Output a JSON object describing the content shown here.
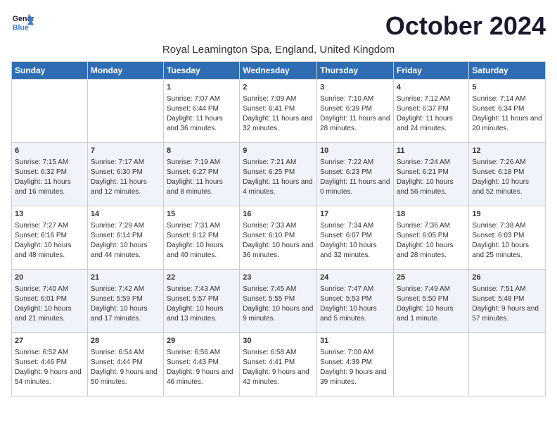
{
  "logo": {
    "line1": "General",
    "line2": "Blue"
  },
  "title": "October 2024",
  "subtitle": "Royal Leamington Spa, England, United Kingdom",
  "days_of_week": [
    "Sunday",
    "Monday",
    "Tuesday",
    "Wednesday",
    "Thursday",
    "Friday",
    "Saturday"
  ],
  "weeks": [
    [
      {
        "day": "",
        "sunrise": "",
        "sunset": "",
        "daylight": ""
      },
      {
        "day": "",
        "sunrise": "",
        "sunset": "",
        "daylight": ""
      },
      {
        "day": "1",
        "sunrise": "Sunrise: 7:07 AM",
        "sunset": "Sunset: 6:44 PM",
        "daylight": "Daylight: 11 hours and 36 minutes."
      },
      {
        "day": "2",
        "sunrise": "Sunrise: 7:09 AM",
        "sunset": "Sunset: 6:41 PM",
        "daylight": "Daylight: 11 hours and 32 minutes."
      },
      {
        "day": "3",
        "sunrise": "Sunrise: 7:10 AM",
        "sunset": "Sunset: 6:39 PM",
        "daylight": "Daylight: 11 hours and 28 minutes."
      },
      {
        "day": "4",
        "sunrise": "Sunrise: 7:12 AM",
        "sunset": "Sunset: 6:37 PM",
        "daylight": "Daylight: 11 hours and 24 minutes."
      },
      {
        "day": "5",
        "sunrise": "Sunrise: 7:14 AM",
        "sunset": "Sunset: 6:34 PM",
        "daylight": "Daylight: 11 hours and 20 minutes."
      }
    ],
    [
      {
        "day": "6",
        "sunrise": "Sunrise: 7:15 AM",
        "sunset": "Sunset: 6:32 PM",
        "daylight": "Daylight: 11 hours and 16 minutes."
      },
      {
        "day": "7",
        "sunrise": "Sunrise: 7:17 AM",
        "sunset": "Sunset: 6:30 PM",
        "daylight": "Daylight: 11 hours and 12 minutes."
      },
      {
        "day": "8",
        "sunrise": "Sunrise: 7:19 AM",
        "sunset": "Sunset: 6:27 PM",
        "daylight": "Daylight: 11 hours and 8 minutes."
      },
      {
        "day": "9",
        "sunrise": "Sunrise: 7:21 AM",
        "sunset": "Sunset: 6:25 PM",
        "daylight": "Daylight: 11 hours and 4 minutes."
      },
      {
        "day": "10",
        "sunrise": "Sunrise: 7:22 AM",
        "sunset": "Sunset: 6:23 PM",
        "daylight": "Daylight: 11 hours and 0 minutes."
      },
      {
        "day": "11",
        "sunrise": "Sunrise: 7:24 AM",
        "sunset": "Sunset: 6:21 PM",
        "daylight": "Daylight: 10 hours and 56 minutes."
      },
      {
        "day": "12",
        "sunrise": "Sunrise: 7:26 AM",
        "sunset": "Sunset: 6:18 PM",
        "daylight": "Daylight: 10 hours and 52 minutes."
      }
    ],
    [
      {
        "day": "13",
        "sunrise": "Sunrise: 7:27 AM",
        "sunset": "Sunset: 6:16 PM",
        "daylight": "Daylight: 10 hours and 48 minutes."
      },
      {
        "day": "14",
        "sunrise": "Sunrise: 7:29 AM",
        "sunset": "Sunset: 6:14 PM",
        "daylight": "Daylight: 10 hours and 44 minutes."
      },
      {
        "day": "15",
        "sunrise": "Sunrise: 7:31 AM",
        "sunset": "Sunset: 6:12 PM",
        "daylight": "Daylight: 10 hours and 40 minutes."
      },
      {
        "day": "16",
        "sunrise": "Sunrise: 7:33 AM",
        "sunset": "Sunset: 6:10 PM",
        "daylight": "Daylight: 10 hours and 36 minutes."
      },
      {
        "day": "17",
        "sunrise": "Sunrise: 7:34 AM",
        "sunset": "Sunset: 6:07 PM",
        "daylight": "Daylight: 10 hours and 32 minutes."
      },
      {
        "day": "18",
        "sunrise": "Sunrise: 7:36 AM",
        "sunset": "Sunset: 6:05 PM",
        "daylight": "Daylight: 10 hours and 28 minutes."
      },
      {
        "day": "19",
        "sunrise": "Sunrise: 7:38 AM",
        "sunset": "Sunset: 6:03 PM",
        "daylight": "Daylight: 10 hours and 25 minutes."
      }
    ],
    [
      {
        "day": "20",
        "sunrise": "Sunrise: 7:40 AM",
        "sunset": "Sunset: 6:01 PM",
        "daylight": "Daylight: 10 hours and 21 minutes."
      },
      {
        "day": "21",
        "sunrise": "Sunrise: 7:42 AM",
        "sunset": "Sunset: 5:59 PM",
        "daylight": "Daylight: 10 hours and 17 minutes."
      },
      {
        "day": "22",
        "sunrise": "Sunrise: 7:43 AM",
        "sunset": "Sunset: 5:57 PM",
        "daylight": "Daylight: 10 hours and 13 minutes."
      },
      {
        "day": "23",
        "sunrise": "Sunrise: 7:45 AM",
        "sunset": "Sunset: 5:55 PM",
        "daylight": "Daylight: 10 hours and 9 minutes."
      },
      {
        "day": "24",
        "sunrise": "Sunrise: 7:47 AM",
        "sunset": "Sunset: 5:53 PM",
        "daylight": "Daylight: 10 hours and 5 minutes."
      },
      {
        "day": "25",
        "sunrise": "Sunrise: 7:49 AM",
        "sunset": "Sunset: 5:50 PM",
        "daylight": "Daylight: 10 hours and 1 minute."
      },
      {
        "day": "26",
        "sunrise": "Sunrise: 7:51 AM",
        "sunset": "Sunset: 5:48 PM",
        "daylight": "Daylight: 9 hours and 57 minutes."
      }
    ],
    [
      {
        "day": "27",
        "sunrise": "Sunrise: 6:52 AM",
        "sunset": "Sunset: 4:46 PM",
        "daylight": "Daylight: 9 hours and 54 minutes."
      },
      {
        "day": "28",
        "sunrise": "Sunrise: 6:54 AM",
        "sunset": "Sunset: 4:44 PM",
        "daylight": "Daylight: 9 hours and 50 minutes."
      },
      {
        "day": "29",
        "sunrise": "Sunrise: 6:56 AM",
        "sunset": "Sunset: 4:43 PM",
        "daylight": "Daylight: 9 hours and 46 minutes."
      },
      {
        "day": "30",
        "sunrise": "Sunrise: 6:58 AM",
        "sunset": "Sunset: 4:41 PM",
        "daylight": "Daylight: 9 hours and 42 minutes."
      },
      {
        "day": "31",
        "sunrise": "Sunrise: 7:00 AM",
        "sunset": "Sunset: 4:39 PM",
        "daylight": "Daylight: 9 hours and 39 minutes."
      },
      {
        "day": "",
        "sunrise": "",
        "sunset": "",
        "daylight": ""
      },
      {
        "day": "",
        "sunrise": "",
        "sunset": "",
        "daylight": ""
      }
    ]
  ]
}
